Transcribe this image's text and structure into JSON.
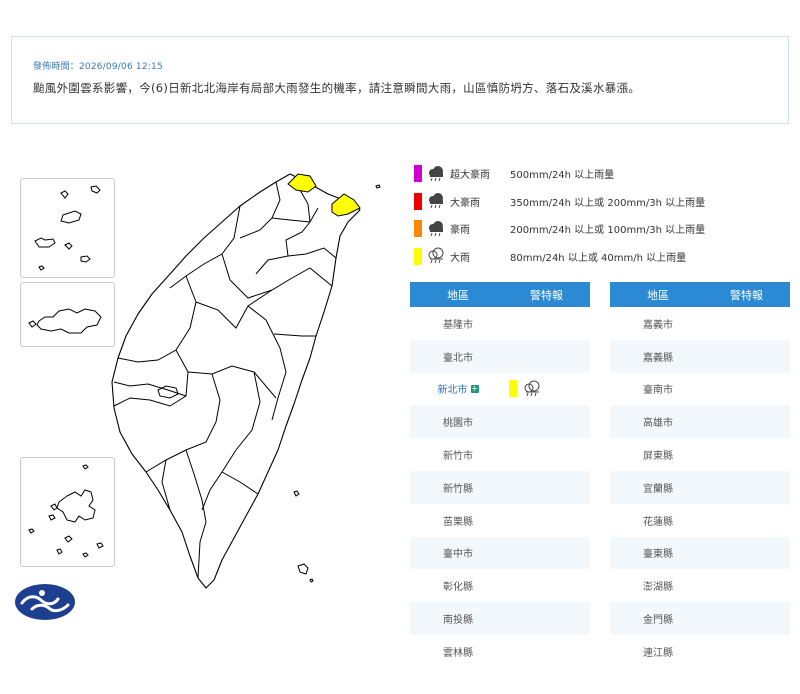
{
  "bulletin": {
    "time": "發佈時間：2026/09/06 12:15",
    "message": "颱風外圍雲系影響，今(6)日新北北海岸有局部大雨發生的機率，請注意瞬間大雨，山區慎防坍方、落石及溪水暴漲。"
  },
  "colors": {
    "heavy_rain_yellow": "#ffff00",
    "header_blue": "#2b8ad3"
  },
  "legend": [
    {
      "name": "超大豪雨",
      "desc": "500mm/24h 以上雨量",
      "color": "#d000d0",
      "icon": "torrential-rain-icon"
    },
    {
      "name": "大豪雨",
      "desc": "350mm/24h 以上或 200mm/3h 以上雨量",
      "color": "#ee0000",
      "icon": "torrential-rain-icon"
    },
    {
      "name": "豪雨",
      "desc": "200mm/24h 以上或 100mm/3h 以上雨量",
      "color": "#ff8800",
      "icon": "torrential-rain-icon"
    },
    {
      "name": "大雨",
      "desc": "80mm/24h 以上或 40mm/h 以上雨量",
      "color": "#ffff00",
      "icon": "heavy-rain-icon"
    }
  ],
  "table": {
    "col_region": "地區",
    "col_warning": "警特報",
    "left": [
      "基隆市",
      "臺北市",
      "新北市",
      "桃園市",
      "新竹市",
      "新竹縣",
      "苗栗縣",
      "臺中市",
      "彰化縣",
      "南投縣",
      "雲林縣"
    ],
    "right": [
      "嘉義市",
      "嘉義縣",
      "臺南市",
      "高雄市",
      "屏東縣",
      "宜蘭縣",
      "花蓮縣",
      "臺東縣",
      "澎湖縣",
      "金門縣",
      "連江縣"
    ],
    "active_region": "新北市",
    "active_warning_icon": "heavy-rain-icon"
  }
}
